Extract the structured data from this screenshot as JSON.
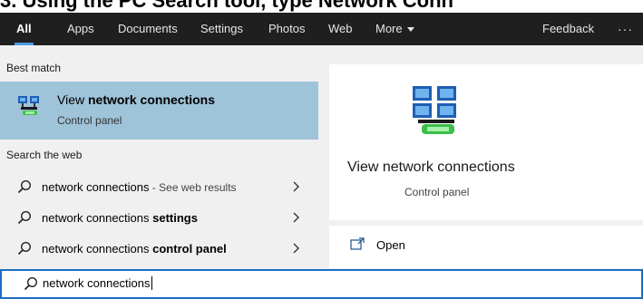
{
  "caption": {
    "text": "3. Using the PC Search tool, type Network Conn"
  },
  "tabs": [
    {
      "label": "All",
      "active": true
    },
    {
      "label": "Apps"
    },
    {
      "label": "Documents"
    },
    {
      "label": "Settings"
    },
    {
      "label": "Photos"
    },
    {
      "label": "Web"
    },
    {
      "label": "More"
    },
    {
      "label": "Feedback"
    }
  ],
  "more_icon": "chevron-down-icon",
  "overflow_label": "···",
  "best_match": {
    "header": "Best match",
    "title_prefix": "View ",
    "title_bold": "network connections",
    "subtitle": "Control panel",
    "icon": "network-connections-icon"
  },
  "web": {
    "header": "Search the web",
    "items": [
      {
        "query": "network connections",
        "bold": "",
        "suffix": " - See web results"
      },
      {
        "query": "network connections ",
        "bold": "settings",
        "suffix": ""
      },
      {
        "query": "network connections ",
        "bold": "control panel",
        "suffix": ""
      }
    ]
  },
  "preview": {
    "title": "View network connections",
    "subtitle": "Control panel",
    "action_open": "Open",
    "icon": "network-connections-icon"
  },
  "search": {
    "value": "network connections",
    "icon": "search-icon"
  },
  "colors": {
    "tabbar_bg": "#1f1f1f",
    "accent": "#4a9be0",
    "selected_row": "#9fc3d9",
    "search_border": "#1d6fc2"
  }
}
